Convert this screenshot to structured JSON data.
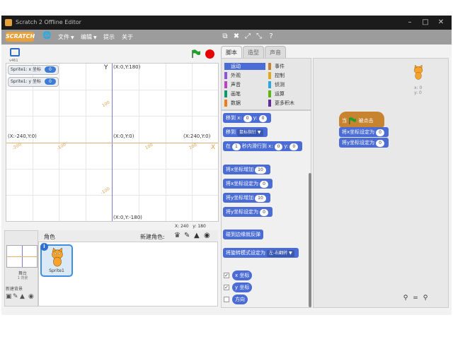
{
  "window": {
    "title": "Scratch 2 Offline Editor"
  },
  "menubar": {
    "logo": "SCRATCH",
    "file": "文件",
    "edit": "编辑",
    "tips": "提示",
    "about": "关于"
  },
  "stage": {
    "version": "v461",
    "y_axis_label": "Y",
    "x_axis_label": "X",
    "top_coord": "(X:0,Y:180)",
    "center_coord": "(X:0,Y:0)",
    "left_coord": "(X:-240,Y:0)",
    "right_coord": "(X:240,Y:0)",
    "bottom_coord": "(X:0,Y:-180)",
    "tick_labels": [
      "-200",
      "-100",
      "100",
      "200",
      "100",
      "-100"
    ],
    "mouse_x_label": "X:",
    "mouse_x": "240",
    "mouse_y_label": "y:",
    "mouse_y": "180"
  },
  "monitors": [
    {
      "label": "Sprite1: x 坐标",
      "value": "0"
    },
    {
      "label": "Sprite1: y 坐标",
      "value": "0"
    }
  ],
  "sprites": {
    "header": "角色",
    "new_sprite_label": "新建角色:",
    "stage_label": "舞台",
    "stage_backdrops": "1 背景",
    "new_backdrop_label": "新建背景",
    "sprite_name": "Sprite1",
    "info_glyph": "i"
  },
  "tabs": [
    "脚本",
    "造型",
    "声音"
  ],
  "categories": [
    {
      "label": "运动",
      "color": "#4a6cd4",
      "selected": true
    },
    {
      "label": "外观",
      "color": "#8a55d7",
      "selected": false
    },
    {
      "label": "声音",
      "color": "#bb42c3",
      "selected": false
    },
    {
      "label": "画笔",
      "color": "#0e9a6c",
      "selected": false
    },
    {
      "label": "数据",
      "color": "#ee7d16",
      "selected": false
    },
    {
      "label": "事件",
      "color": "#c88330",
      "selected": false
    },
    {
      "label": "控制",
      "color": "#e1a91a",
      "selected": false
    },
    {
      "label": "侦测",
      "color": "#2ca5e2",
      "selected": false
    },
    {
      "label": "运算",
      "color": "#5cb712",
      "selected": false
    },
    {
      "label": "更多积木",
      "color": "#632d99",
      "selected": false
    }
  ],
  "blocks": {
    "goto_xy_prefix": "移到 x:",
    "goto_xy_x": "0",
    "goto_xy_ymid": "y:",
    "goto_xy_y": "0",
    "goto_prefix": "移到",
    "goto_target": "鼠标指针",
    "glide_prefix": "在",
    "glide_secs": "1",
    "glide_mid": "秒内滑行到 x:",
    "glide_x": "0",
    "glide_ymid": "y:",
    "glide_y": "0",
    "change_x": "将x坐标增加",
    "change_x_val": "10",
    "set_x": "将x坐标设定为",
    "set_x_val": "0",
    "change_y": "将y坐标增加",
    "change_y_val": "10",
    "set_y": "将y坐标设定为",
    "set_y_val": "0",
    "bounce": "碰到边缘就反弹",
    "rotation_style": "将旋转模式设定为",
    "rotation_style_val": "左-右翻转",
    "rep_x": "x 坐标",
    "rep_y": "y 坐标",
    "rep_dir": "方向"
  },
  "script": {
    "hat_prefix": "当",
    "hat_suffix": "被点击",
    "set_x": "将x坐标设定为",
    "set_x_val": "0",
    "set_y": "将y坐标设定为",
    "set_y_val": "0",
    "sprite_x": "x: 0",
    "sprite_y": "y: 0"
  },
  "colors": {
    "motion": "#4a6cd4",
    "events": "#c88330",
    "stop": "#e60000",
    "flag": "#1fa02c",
    "menubar": "#9c9c9c"
  }
}
